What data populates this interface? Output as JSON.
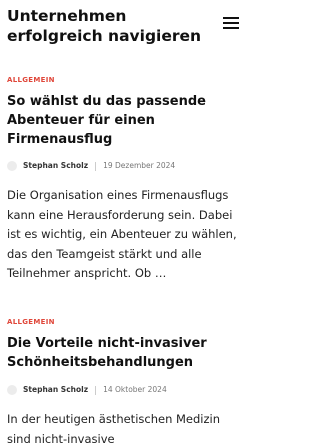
{
  "site": {
    "title": "Unternehmen erfolgreich navigieren",
    "menu_icon": "hamburger-menu-icon"
  },
  "colors": {
    "category": "#e0473a",
    "text": "#111111",
    "muted": "#777777"
  },
  "posts": [
    {
      "category": "ALLGEMEIN",
      "title": "So wählst du das passende Abenteuer für einen Firmenausflug",
      "author": "Stephan Scholz",
      "date": "19 Dezember 2024",
      "excerpt": "Die Organisation eines Firmenausflugs kann eine Herausforderung sein. Dabei ist es wichtig, ein Abenteuer zu wählen, das den Teamgeist stärkt und alle Teilnehmer anspricht. Ob …"
    },
    {
      "category": "ALLGEMEIN",
      "title": "Die Vorteile nicht-invasiver Schönheitsbehandlungen",
      "author": "Stephan Scholz",
      "date": "14 Oktober 2024",
      "excerpt": "In der heutigen ästhetischen Medizin sind nicht-invasive"
    }
  ]
}
